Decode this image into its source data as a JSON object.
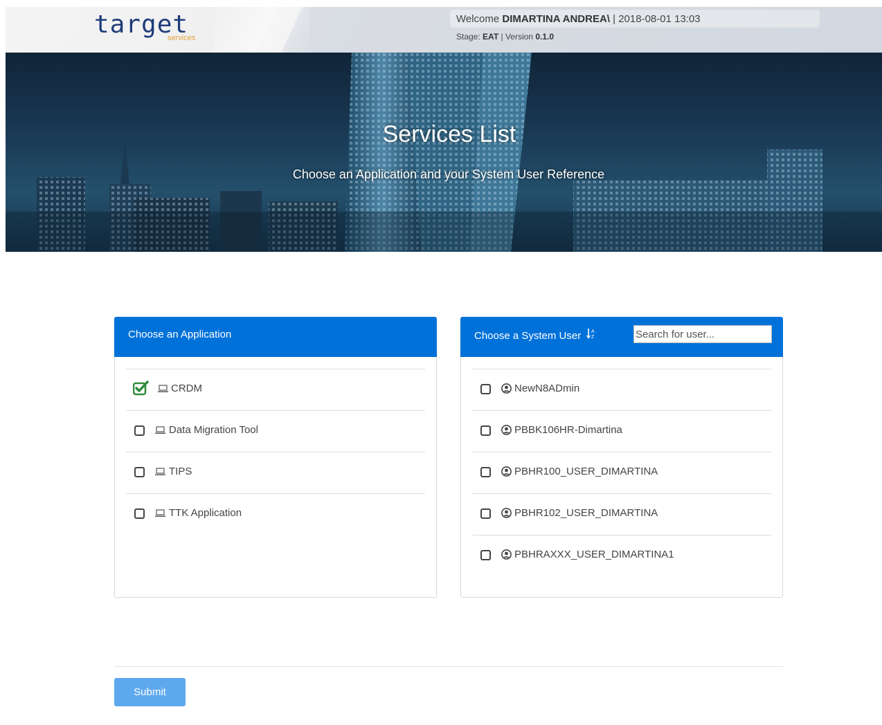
{
  "header": {
    "logo_text": "target",
    "logo_sub": "services",
    "welcome_prefix": "Welcome",
    "user_name": "DIMARTINA ANDREA\\",
    "datetime": "| 2018-08-01 13:03",
    "stage_label": "Stage:",
    "stage_value": "EAT",
    "version_label": "| Version",
    "version_value": "0.1.0"
  },
  "banner": {
    "title": "Services List",
    "subtitle": "Choose an Application and your System User Reference"
  },
  "applications": {
    "title": "Choose an Application",
    "items": [
      {
        "label": "CRDM",
        "checked": true
      },
      {
        "label": "Data Migration Tool",
        "checked": false
      },
      {
        "label": "TIPS",
        "checked": false
      },
      {
        "label": "TTK Application",
        "checked": false
      }
    ]
  },
  "users": {
    "title": "Choose a System User",
    "sort_icon": "sort-alpha-icon",
    "search_placeholder": "Search for user...",
    "items": [
      {
        "label": "NewN8ADmin",
        "checked": false
      },
      {
        "label": "PBBK106HR-Dimartina",
        "checked": false
      },
      {
        "label": "PBHR100_USER_DIMARTINA",
        "checked": false
      },
      {
        "label": "PBHR102_USER_DIMARTINA",
        "checked": false
      },
      {
        "label": "PBHRAXXX_USER_DIMARTINA1",
        "checked": false
      }
    ]
  },
  "footer": {
    "submit_label": "Submit"
  },
  "colors": {
    "panel_header": "#0071d9",
    "submit": "#5ea8ee",
    "checked": "#2e8b3a",
    "logo": "#1f3c7a",
    "logo_sub": "#e8a23a"
  }
}
